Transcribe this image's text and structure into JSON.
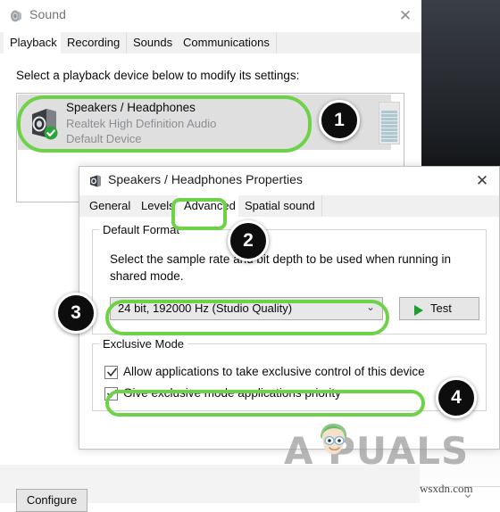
{
  "sound_window": {
    "title": "Sound",
    "title_icon": "speaker-icon",
    "close_label": "✕",
    "tabs": [
      {
        "label": "Playback",
        "active": true
      },
      {
        "label": "Recording",
        "active": false
      },
      {
        "label": "Sounds",
        "active": false
      },
      {
        "label": "Communications",
        "active": false
      }
    ],
    "prompt": "Select a playback device below to modify its settings:",
    "device": {
      "name": "Speakers / Headphones",
      "driver": "Realtek High Definition Audio",
      "status": "Default Device",
      "icon": "speaker-device-icon",
      "badge": "default-check-badge",
      "meter": "volume-level-meter"
    },
    "configure_label": "Configure"
  },
  "properties_window": {
    "title": "Speakers / Headphones Properties",
    "title_icon": "speaker-icon",
    "close_label": "✕",
    "tabs": [
      {
        "label": "General",
        "active": false
      },
      {
        "label": "Levels",
        "active": false
      },
      {
        "label": "Advanced",
        "active": true
      },
      {
        "label": "Spatial sound",
        "active": false
      }
    ],
    "default_format": {
      "legend": "Default Format",
      "description": "Select the sample rate and bit depth to be used when running in shared mode.",
      "selected_value": "24 bit, 192000 Hz (Studio Quality)",
      "dropdown_arrow": "⌄",
      "test_label": "Test",
      "test_icon": "play-triangle-icon"
    },
    "exclusive_mode": {
      "legend": "Exclusive Mode",
      "checkboxes": [
        {
          "label": "Allow applications to take exclusive control of this device",
          "checked": true
        },
        {
          "label": "Give exclusive mode applications priority",
          "checked": true
        }
      ]
    }
  },
  "annotations": {
    "highlight_color": "#6ed249",
    "callouts": [
      {
        "number": "1",
        "target": "playback-device-row"
      },
      {
        "number": "2",
        "target": "advanced-tab"
      },
      {
        "number": "3",
        "target": "default-format-dropdown"
      },
      {
        "number": "4",
        "target": "exclusive-control-checkbox"
      }
    ]
  },
  "watermark": {
    "brand": "A   PUALS",
    "site_credit": "wsxdn.com"
  },
  "desktop": {
    "chevron": "⌄"
  }
}
